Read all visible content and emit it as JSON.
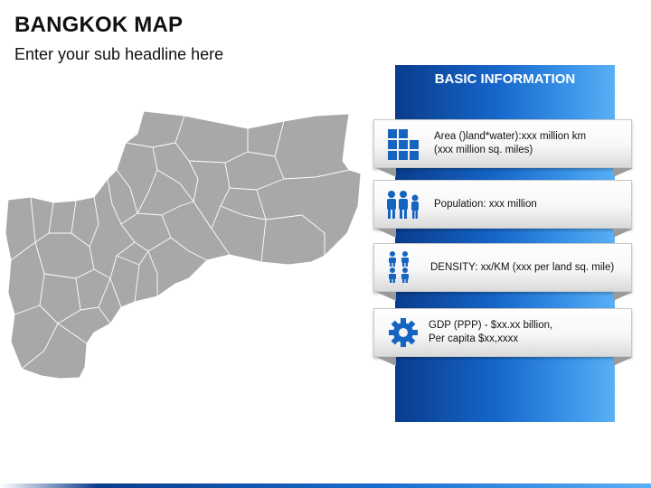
{
  "header": {
    "title": "BANGKOK MAP",
    "subtitle": "Enter your sub headline here"
  },
  "map": {
    "fill": "#a8a8a8",
    "stroke": "#ffffff"
  },
  "panel": {
    "title": "BASIC INFORMATION",
    "colors": {
      "dark": "#0a3c8c",
      "light": "#5ab0f5",
      "icon": "#1565c0"
    }
  },
  "info": [
    {
      "icon": "grid-blocks-icon",
      "line1": "Area ()land*water):xxx million km",
      "line2": "(xxx million sq. miles)"
    },
    {
      "icon": "people-group-icon",
      "line1": "Population: xxx million",
      "line2": ""
    },
    {
      "icon": "people-density-icon",
      "line1": "DENSITY: xx/KM (xxx per land sq. mile)",
      "line2": ""
    },
    {
      "icon": "gear-icon",
      "line1": "GDP (PPP) - $xx.xx billion,",
      "line2": "Per capita $xx,xxxx"
    }
  ]
}
